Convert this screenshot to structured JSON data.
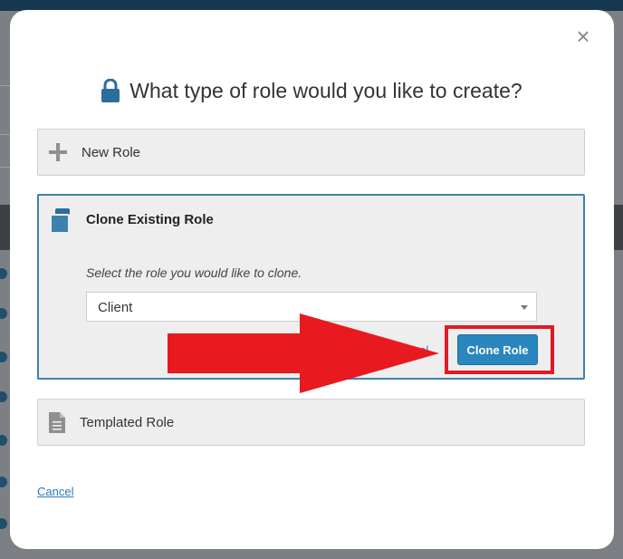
{
  "modal": {
    "title": "What type of role would you like to create?",
    "close_label": "×",
    "options": {
      "new_role": {
        "label": "New Role"
      },
      "clone_role": {
        "label": "Clone Existing Role",
        "hint": "Select the role you would like to clone.",
        "select_value": "Client",
        "cancel_fragment": "rel",
        "button_label": "Clone Role"
      },
      "templated_role": {
        "label": "Templated Role"
      }
    },
    "cancel_label": "Cancel"
  },
  "colors": {
    "accent": "#3b83ae",
    "button": "#2a86bf",
    "annotation": "#e01b24",
    "link": "#2a7ab8"
  },
  "icons": [
    "lock-icon",
    "plus-icon",
    "clone-icon",
    "document-icon",
    "close-icon",
    "chevron-down-icon",
    "arrow-annotation"
  ]
}
